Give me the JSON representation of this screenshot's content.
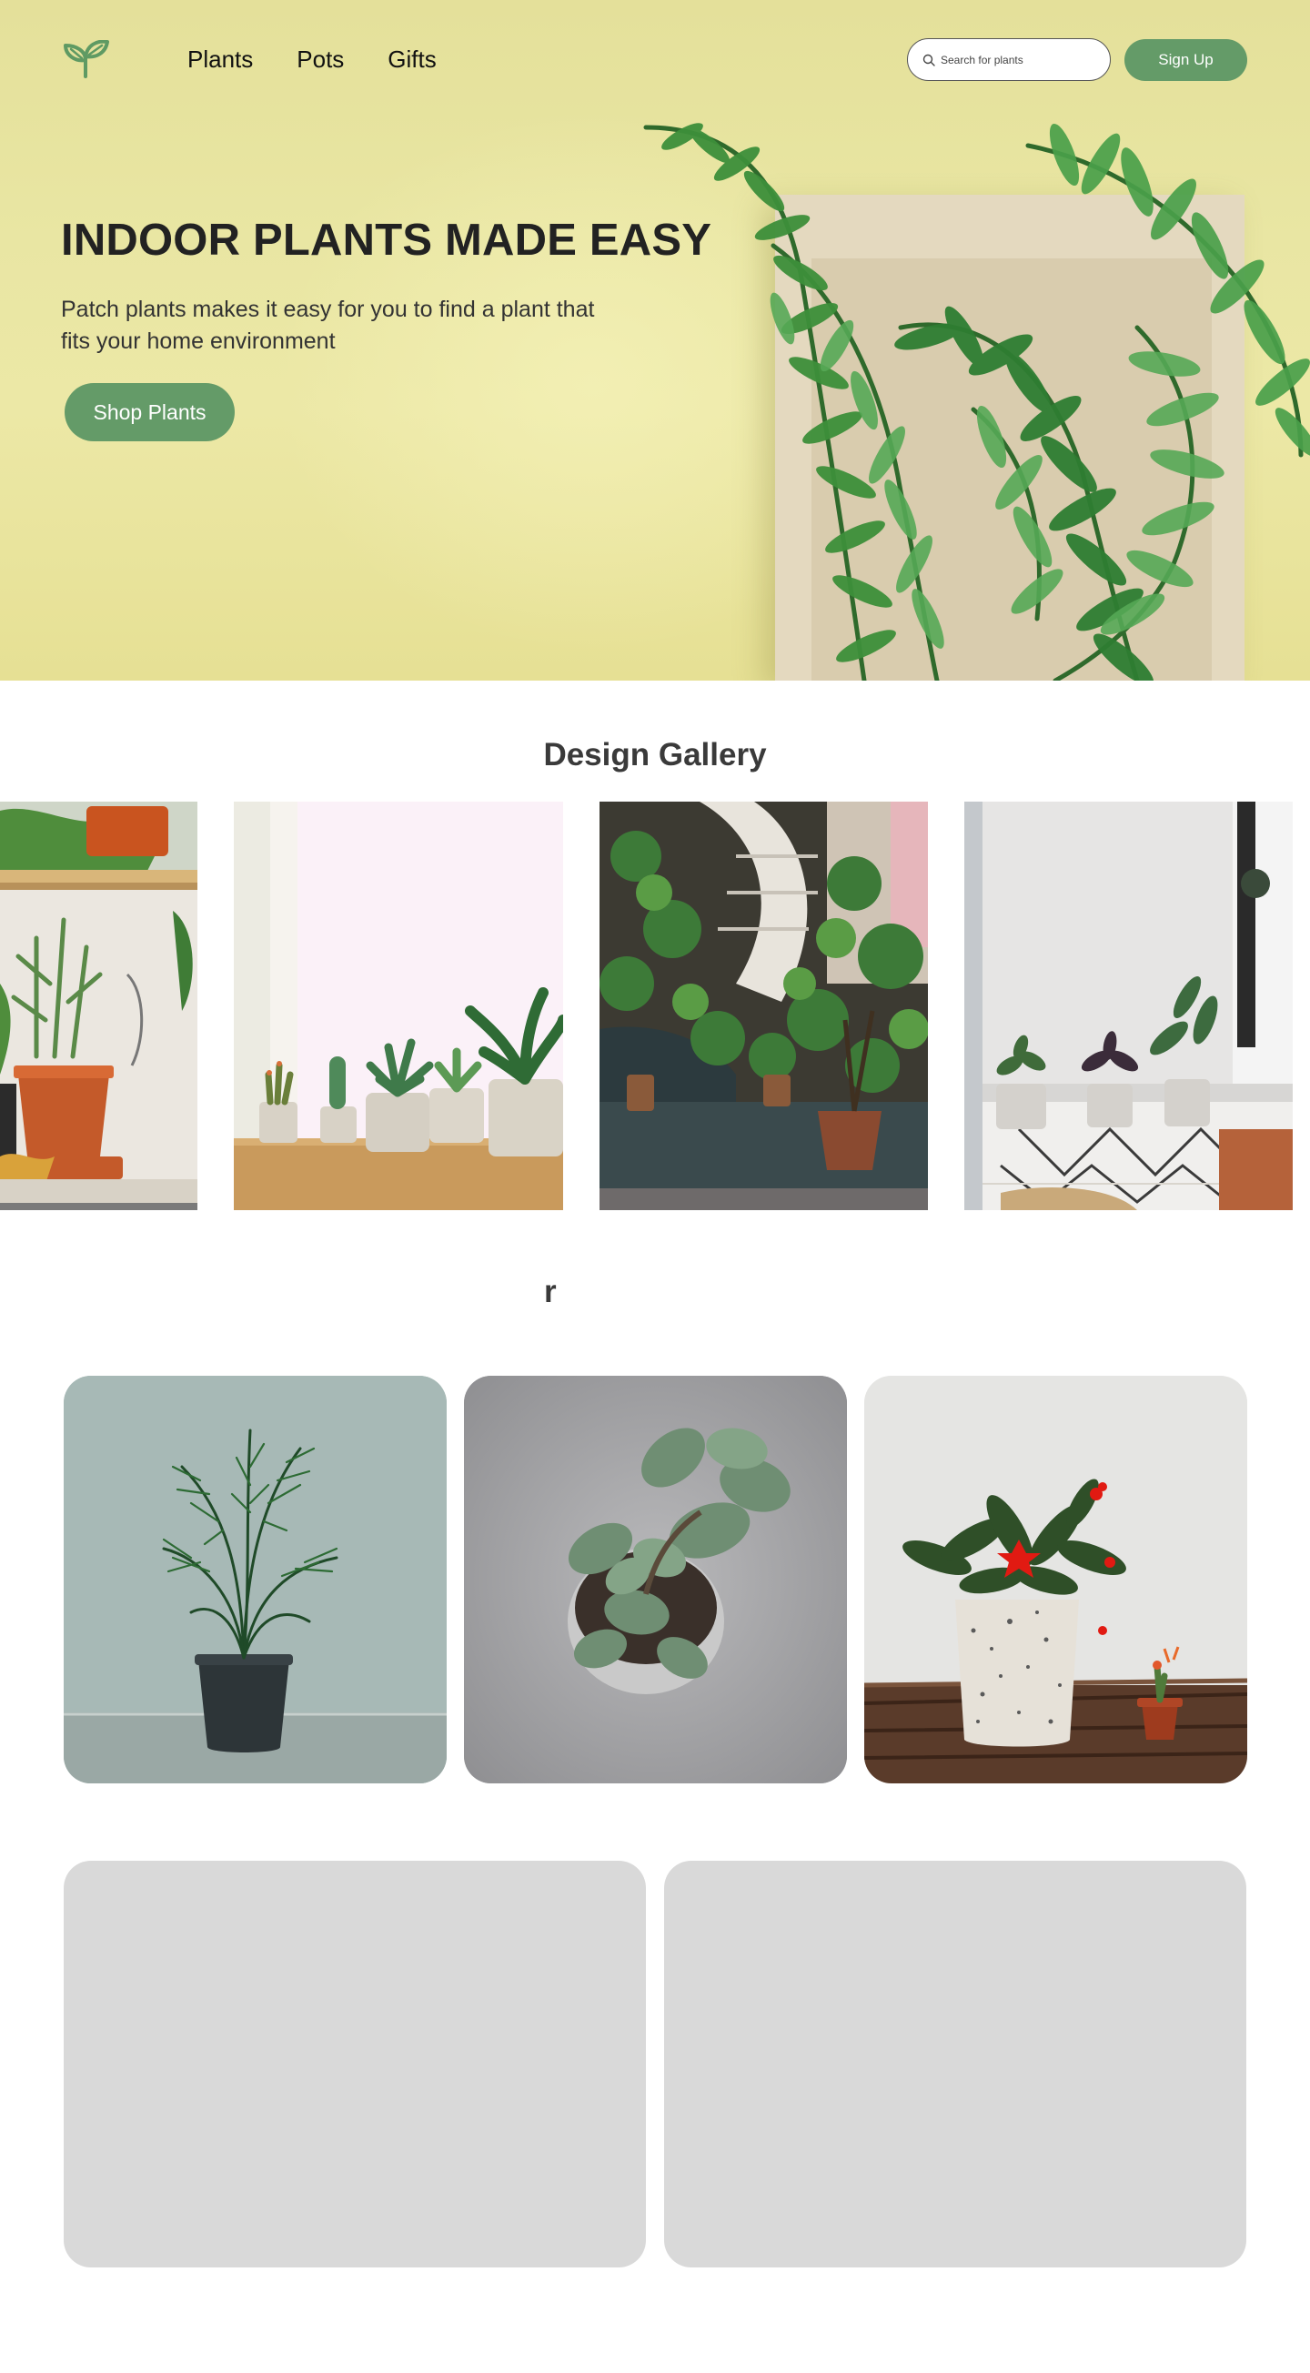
{
  "nav": {
    "logo_icon": "sprout-icon",
    "links": [
      {
        "label": "Plants"
      },
      {
        "label": "Pots"
      },
      {
        "label": "Gifts"
      }
    ],
    "search": {
      "placeholder": "Search for plants",
      "icon": "search-icon"
    },
    "signup_label": "Sign Up"
  },
  "hero": {
    "title": "INDOOR PLANTS MADE EASY",
    "subtitle": "Patch plants makes it easy for you to find a plant that fits your home environment",
    "cta_label": "Shop Plants"
  },
  "gallery": {
    "title": "Design Gallery"
  },
  "category": {
    "title": "r"
  },
  "colors": {
    "accent": "#649b68",
    "hero_bg": "#e9e6a3",
    "heading": "#3a3a3a",
    "placeholder_card": "#d9d9d9"
  }
}
